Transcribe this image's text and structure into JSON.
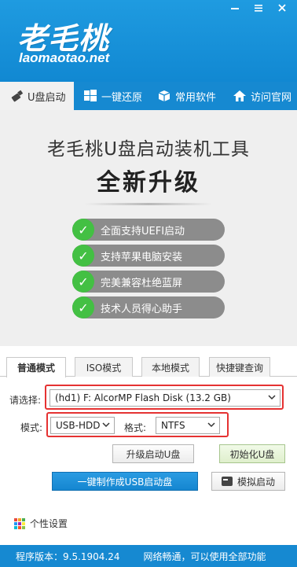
{
  "header": {
    "logo_text": "老毛桃",
    "logo_url": "laomaotao.net"
  },
  "top_tabs": [
    {
      "label": "U盘启动"
    },
    {
      "label": "一键还原"
    },
    {
      "label": "常用软件"
    },
    {
      "label": "访问官网"
    }
  ],
  "main": {
    "title": "老毛桃U盘启动装机工具",
    "subtitle": "全新升级",
    "features": [
      "全面支持UEFI启动",
      "支持苹果电脑安装",
      "完美兼容杜绝蓝屏",
      "技术人员得心助手"
    ]
  },
  "mode_tabs": [
    {
      "label": "普通模式"
    },
    {
      "label": "ISO模式"
    },
    {
      "label": "本地模式"
    },
    {
      "label": "快捷键查询"
    }
  ],
  "form": {
    "device_label": "请选择:",
    "device_value": "(hd1) F: AlcorMP Flash Disk (13.2 GB)",
    "mode_label": "模式:",
    "mode_value": "USB-HDD",
    "format_label": "格式:",
    "format_value": "NTFS"
  },
  "buttons": {
    "upgrade": "升级启动U盘",
    "init": "初始化U盘",
    "make": "一键制作成USB启动盘",
    "simulate": "模拟启动"
  },
  "settings_label": "个性设置",
  "status": {
    "version": "程序版本：9.5.1904.24",
    "message": "网络畅通，可以使用全部功能"
  },
  "colors": {
    "brand_blue": "#1689d1",
    "check_green": "#43c043",
    "highlight_red": "#e53232"
  }
}
